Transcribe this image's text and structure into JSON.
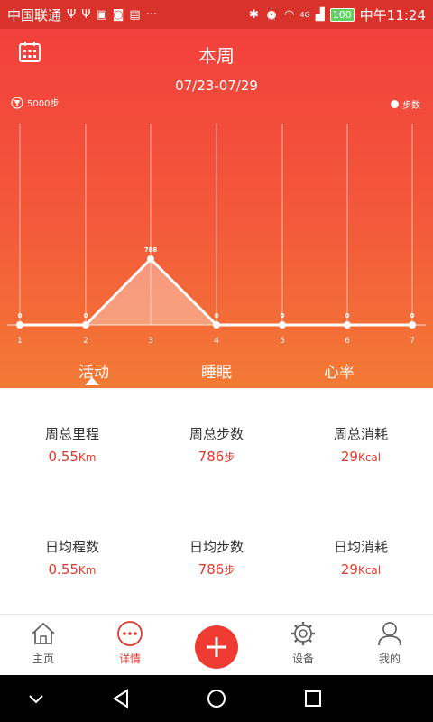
{
  "status_bar": {
    "carrier": "中国联通",
    "left_icons": [
      "usb-icon",
      "usb-icon",
      "lock-app-icon",
      "photo-app-icon",
      "record-app-icon",
      "more-dots"
    ],
    "signal_label": "4G",
    "battery": "100",
    "time": "中午11:24"
  },
  "header": {
    "title": "本周",
    "date_range": "07/23-07/29",
    "goal_label": "5000步",
    "legend_label": "步数"
  },
  "chart_data": {
    "type": "line",
    "x": [
      "1",
      "2",
      "3",
      "4",
      "5",
      "6",
      "7"
    ],
    "series": [
      {
        "name": "步数",
        "values": [
          0,
          0,
          786,
          0,
          0,
          0,
          0
        ]
      }
    ],
    "data_labels": [
      "0",
      "0",
      "786",
      "0",
      "0",
      "0",
      "0"
    ],
    "ylim": [
      0,
      2400
    ],
    "grid": true,
    "legend": "top-right"
  },
  "tabs": [
    {
      "label": "活动",
      "active": true
    },
    {
      "label": "睡眠",
      "active": false
    },
    {
      "label": "心率",
      "active": false
    }
  ],
  "stats": [
    {
      "label": "周总里程",
      "value": "0.55",
      "unit": "Km"
    },
    {
      "label": "周总步数",
      "value": "786",
      "unit": "步"
    },
    {
      "label": "周总消耗",
      "value": "29",
      "unit": "Kcal"
    },
    {
      "label": "日均程数",
      "value": "0.55",
      "unit": "Km"
    },
    {
      "label": "日均步数",
      "value": "786",
      "unit": "步"
    },
    {
      "label": "日均消耗",
      "value": "29",
      "unit": "Kcal"
    }
  ],
  "bottom_nav": {
    "home": "主页",
    "details": "详情",
    "devices": "设备",
    "mine": "我的"
  },
  "colors": {
    "accent": "#e23a2e",
    "header_top": "#f2403c",
    "header_bottom": "#f37a35"
  }
}
